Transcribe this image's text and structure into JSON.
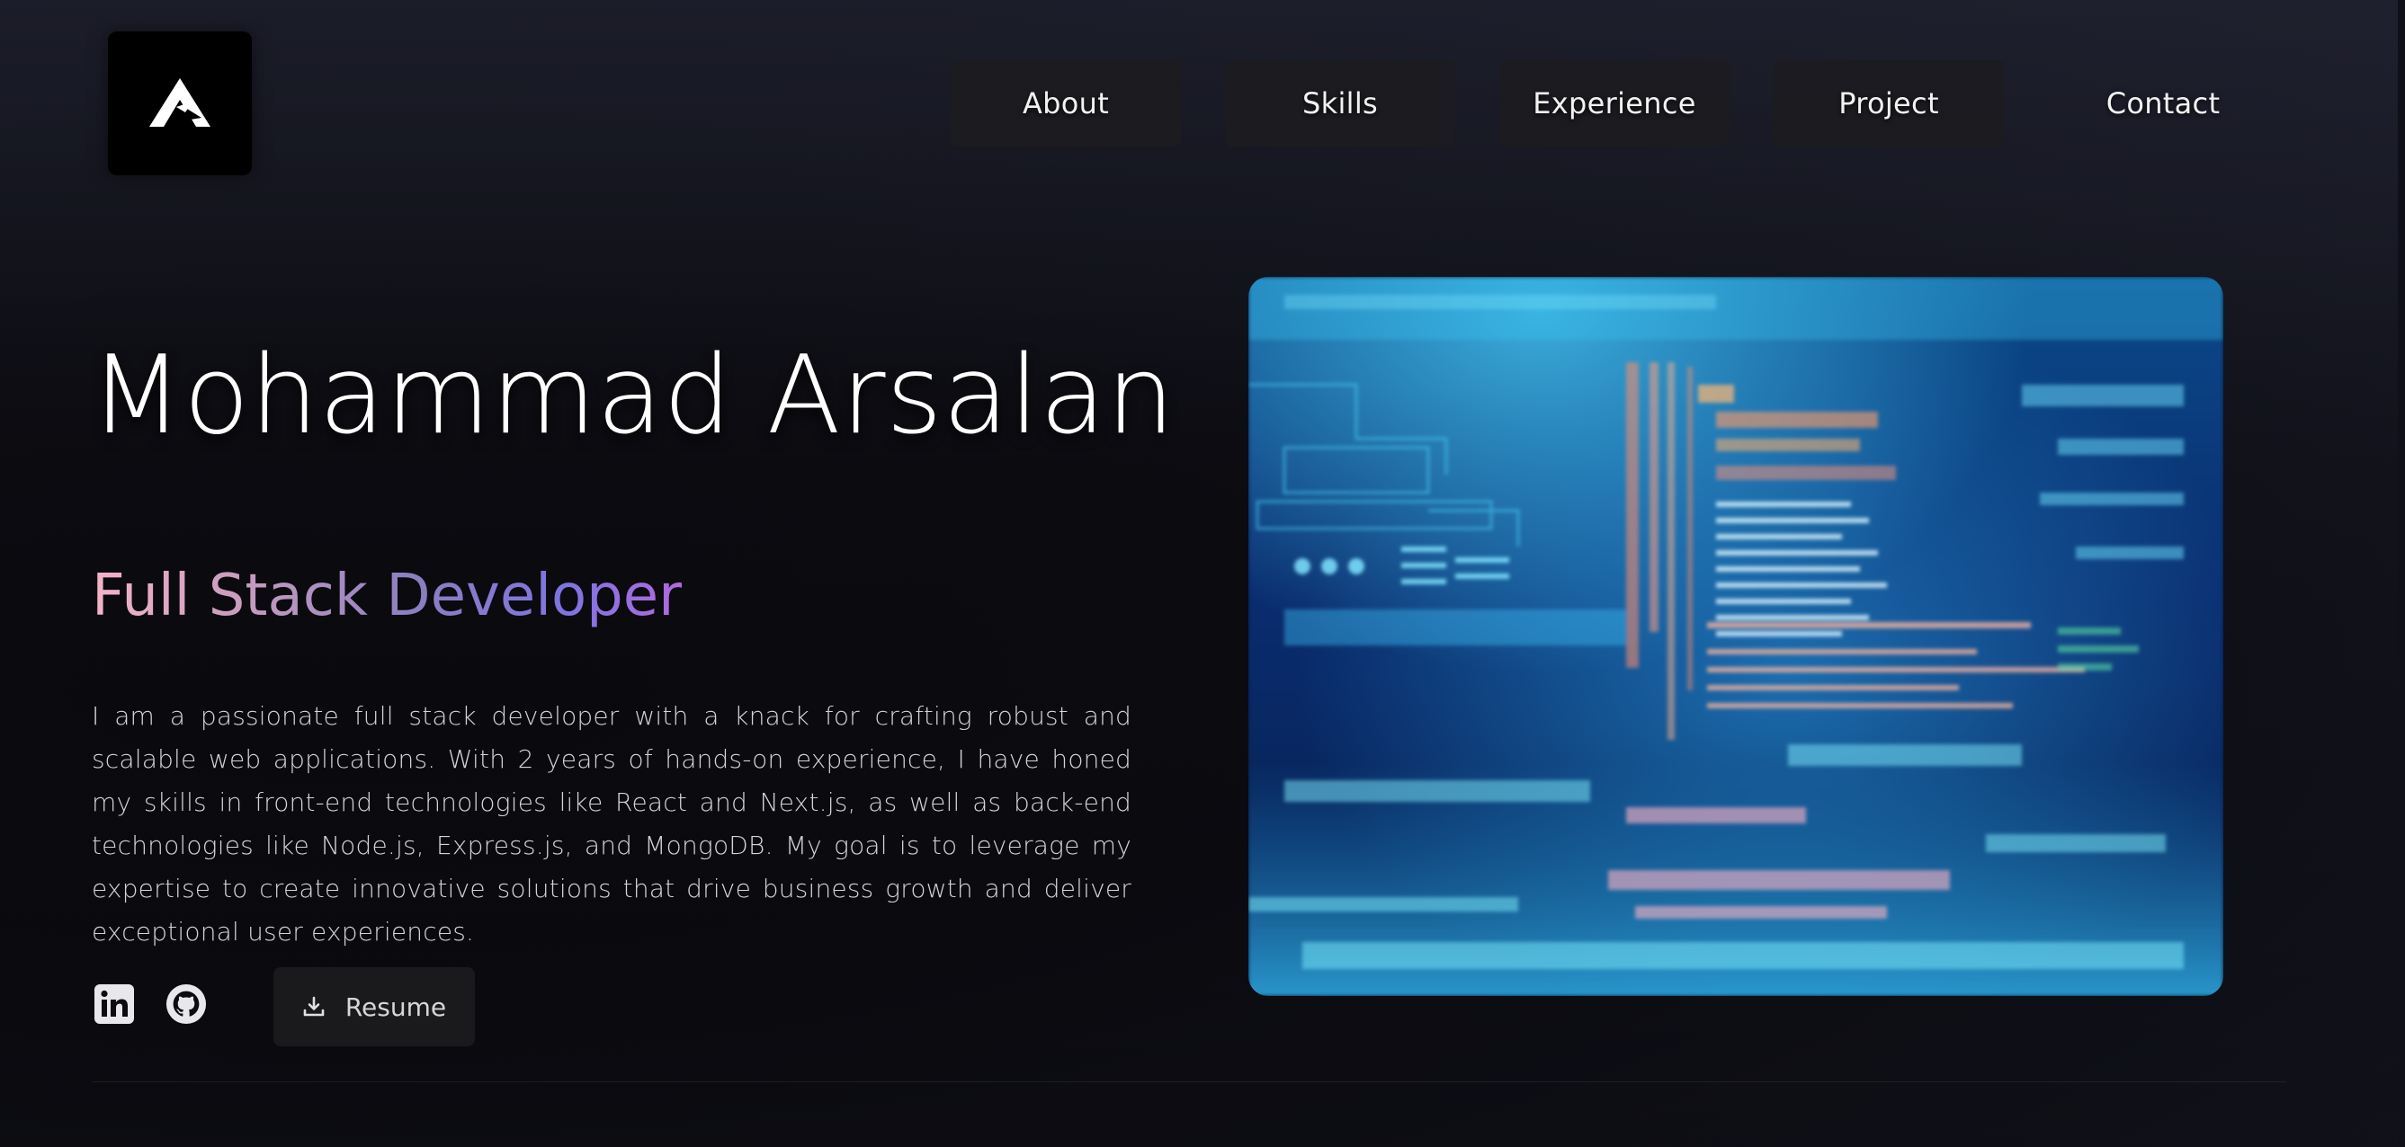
{
  "nav": {
    "items": [
      "About",
      "Skills",
      "Experience",
      "Project",
      "Contact"
    ]
  },
  "hero": {
    "name": "Mohammad Arsalan",
    "role": "Full Stack Developer",
    "description": "I am a passionate full stack developer with a knack for crafting robust and scalable web applications. With 2 years of hands-on experience, I have honed my skills in front-end technologies like React and Next.js, as well as back-end technologies like Node.js, Express.js, and MongoDB. My goal is to leverage my expertise to create innovative solutions that drive business growth and deliver exceptional user experiences.",
    "resume_label": "Resume"
  },
  "icons": {
    "logo": "logo-icon",
    "linkedin": "linkedin-icon",
    "github": "github-icon",
    "download": "download-icon"
  },
  "colors": {
    "background": "#0b0b10",
    "nav_button": "#1c1c20",
    "role_gradient_start": "#f4b4c8",
    "role_gradient_end": "#b06adf"
  }
}
